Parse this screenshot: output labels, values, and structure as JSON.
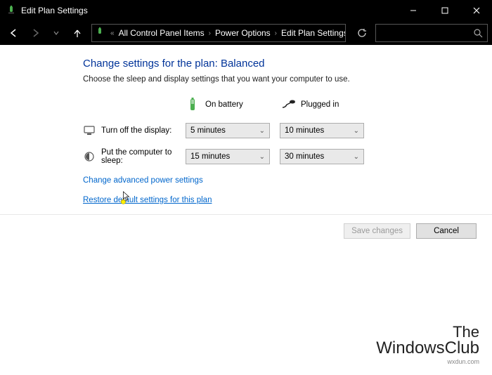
{
  "window": {
    "title": "Edit Plan Settings"
  },
  "breadcrumb": {
    "item1": "All Control Panel Items",
    "item2": "Power Options",
    "item3": "Edit Plan Settings"
  },
  "page": {
    "heading": "Change settings for the plan: Balanced",
    "subtext": "Choose the sleep and display settings that you want your computer to use."
  },
  "columns": {
    "battery": "On battery",
    "plugged": "Plugged in"
  },
  "rows": {
    "display": {
      "label": "Turn off the display:",
      "battery": "5 minutes",
      "plugged": "10 minutes"
    },
    "sleep": {
      "label": "Put the computer to sleep:",
      "battery": "15 minutes",
      "plugged": "30 minutes"
    }
  },
  "links": {
    "advanced": "Change advanced power settings",
    "restore": "Restore default settings for this plan"
  },
  "buttons": {
    "save": "Save changes",
    "cancel": "Cancel"
  },
  "watermark": {
    "line1": "The",
    "line2": "WindowsClub",
    "sub": "wxdun.com"
  }
}
